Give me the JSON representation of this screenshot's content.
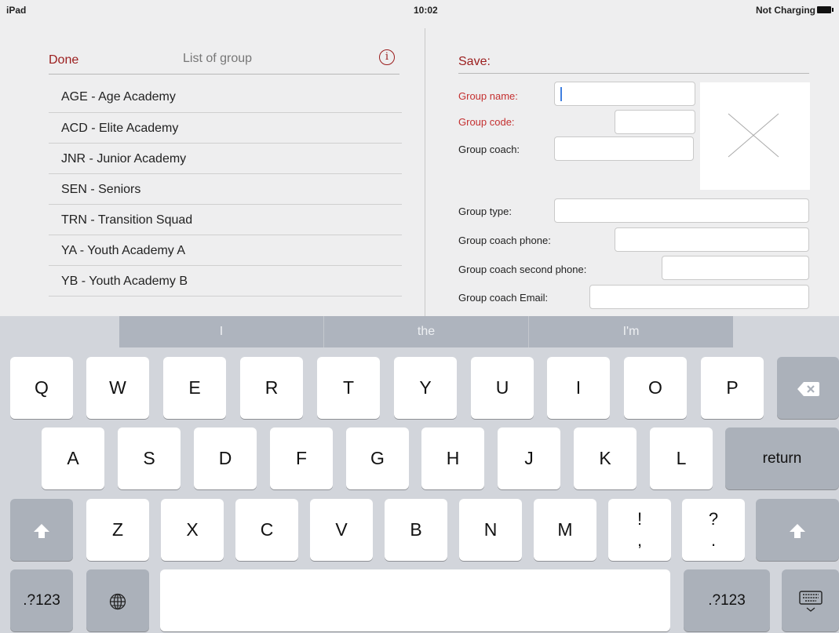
{
  "status": {
    "device": "iPad",
    "time": "10:02",
    "battery": "Not Charging"
  },
  "left": {
    "done": "Done",
    "title": "List of group",
    "info": "i",
    "groups": [
      "AGE - Age Academy",
      "ACD - Elite Academy",
      "JNR - Junior Academy",
      "SEN - Seniors",
      "TRN - Transition Squad",
      "YA - Youth Academy A",
      "YB - Youth Academy B"
    ]
  },
  "right": {
    "save": "Save:",
    "labels": {
      "name": "Group name:",
      "code": "Group code:",
      "coach": "Group coach:",
      "type": "Group type:",
      "phone": "Group coach phone:",
      "phone2": "Group coach second phone:",
      "email": "Group coach Email:"
    },
    "values": {
      "name": "",
      "code": "",
      "coach": "",
      "type": "",
      "phone": "",
      "phone2": "",
      "email": ""
    }
  },
  "keyboard": {
    "suggestions": [
      "I",
      "the",
      "I'm"
    ],
    "row1": [
      "Q",
      "W",
      "E",
      "R",
      "T",
      "Y",
      "U",
      "I",
      "O",
      "P"
    ],
    "row2": [
      "A",
      "S",
      "D",
      "F",
      "G",
      "H",
      "J",
      "K",
      "L"
    ],
    "return": "return",
    "row3": [
      "Z",
      "X",
      "C",
      "V",
      "B",
      "N",
      "M"
    ],
    "punct1": {
      "top": "!",
      "bottom": ","
    },
    "punct2": {
      "top": "?",
      "bottom": "."
    },
    "numbers": ".?123"
  }
}
